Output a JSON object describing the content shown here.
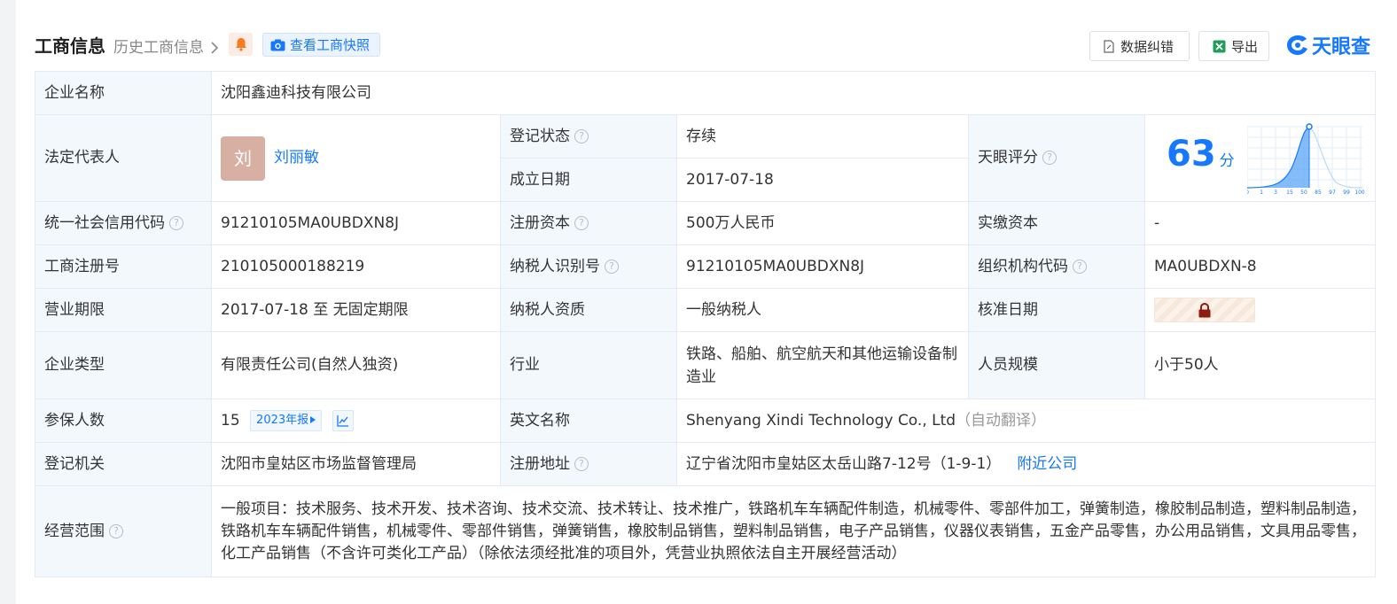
{
  "header": {
    "title": "工商信息",
    "history_link": "历史工商信息",
    "snapshot_button": "查看工商快照",
    "correct_button": "数据纠错",
    "export_button": "导出",
    "logo_text": "天眼查"
  },
  "info": {
    "company_name_label": "企业名称",
    "company_name": "沈阳鑫迪科技有限公司",
    "legal_rep_label": "法定代表人",
    "legal_rep_avatar": "刘",
    "legal_rep_name": "刘丽敏",
    "reg_status_label": "登记状态",
    "reg_status": "存续",
    "found_date_label": "成立日期",
    "found_date": "2017-07-18",
    "score_label": "天眼评分",
    "score": "63",
    "score_unit": "分",
    "score_ticks": [
      "0",
      "1",
      "3",
      "15",
      "50",
      "85",
      "97",
      "99",
      "100"
    ],
    "credit_code_label": "统一社会信用代码",
    "credit_code": "91210105MA0UBDXN8J",
    "reg_capital_label": "注册资本",
    "reg_capital": "500万人民币",
    "paid_capital_label": "实缴资本",
    "paid_capital": "-",
    "reg_no_label": "工商注册号",
    "reg_no": "210105000188219",
    "taxpayer_id_label": "纳税人识别号",
    "taxpayer_id": "91210105MA0UBDXN8J",
    "org_code_label": "组织机构代码",
    "org_code": "MA0UBDXN-8",
    "term_label": "营业期限",
    "term": "2017-07-18 至 无固定期限",
    "taxpayer_qual_label": "纳税人资质",
    "taxpayer_qual": "一般纳税人",
    "approve_date_label": "核准日期",
    "type_label": "企业类型",
    "type": "有限责任公司(自然人独资)",
    "industry_label": "行业",
    "industry": "铁路、船舶、航空航天和其他运输设备制造业",
    "staff_label": "人员规模",
    "staff": "小于50人",
    "insured_label": "参保人数",
    "insured": "15",
    "insured_year_tag": "2023年报",
    "en_name_label": "英文名称",
    "en_name": "Shenyang Xindi Technology Co., Ltd",
    "en_name_note": "（自动翻译）",
    "authority_label": "登记机关",
    "authority": "沈阳市皇姑区市场监督管理局",
    "address_label": "注册地址",
    "address": "辽宁省沈阳市皇姑区太岳山路7-12号（1-9-1）",
    "nearby_link": "附近公司",
    "scope_label": "经营范围",
    "scope": "一般项目：技术服务、技术开发、技术咨询、技术交流、技术转让、技术推广，铁路机车车辆配件制造，机械零件、零部件加工，弹簧制造，橡胶制品制造，塑料制品制造，铁路机车车辆配件销售，机械零件、零部件销售，弹簧销售，橡胶制品销售，塑料制品销售，电子产品销售，仪器仪表销售，五金产品零售，办公用品销售，文具用品零售，化工产品销售（不含许可类化工产品）（除依法须经批准的项目外，凭营业执照依法自主开展经营活动）"
  },
  "colors": {
    "accent": "#1677ff",
    "status_green": "#12a25e",
    "label_bg": "#f3f8fd"
  }
}
